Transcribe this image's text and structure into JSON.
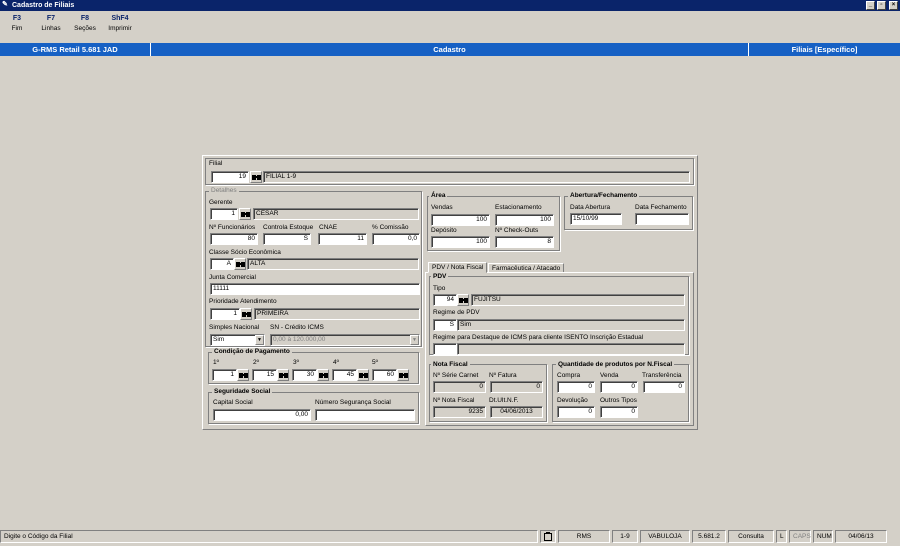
{
  "window": {
    "title": "Cadastro de Filiais"
  },
  "fkeys": [
    {
      "key": "F3",
      "label": "Fim"
    },
    {
      "key": "F7",
      "label": "Linhas"
    },
    {
      "key": "F8",
      "label": "Seções"
    },
    {
      "key": "ShF4",
      "label": "Imprimir"
    }
  ],
  "banner": {
    "left": "G-RMS Retail 5.681 JAD",
    "center": "Cadastro",
    "right": "Filiais [Específico]"
  },
  "filial": {
    "label": "Filial",
    "code": "19",
    "name": "FILIAL 1-9"
  },
  "detalhes": {
    "title": "Detalhes",
    "gerente_label": "Gerente",
    "gerente_code": "1",
    "gerente_name": "CESAR",
    "nfunc_label": "Nº Funcionários",
    "nfunc": "80",
    "ctrl_estoque_label": "Controla Estoque",
    "ctrl_estoque": "S",
    "cnae_label": "CNAE",
    "cnae": "11",
    "comissao_label": "% Comissão",
    "comissao": "0,0",
    "classe_label": "Classe Sócio Econômica",
    "classe_code": "A",
    "classe_name": "ALTA",
    "junta_label": "Junta Comercial",
    "junta": "11111",
    "prioridade_label": "Prioridade Atendimento",
    "prioridade_code": "1",
    "prioridade_name": "PRIMEIRA",
    "simples_label": "Simples Nacional",
    "simples": "Sim",
    "sn_credito_label": "SN - Crédito ICMS",
    "sn_credito": "0,00 à 120.000,00"
  },
  "condicao": {
    "title": "Condição de Pagamento",
    "items": [
      {
        "label": "1º",
        "value": "1"
      },
      {
        "label": "2º",
        "value": "15"
      },
      {
        "label": "3º",
        "value": "30"
      },
      {
        "label": "4º",
        "value": "45"
      },
      {
        "label": "5º",
        "value": "60"
      }
    ]
  },
  "seguridade": {
    "title": "Seguridade Social",
    "capital_label": "Capital Social",
    "capital": "0,00",
    "numero_label": "Número Segurança Social",
    "numero": ""
  },
  "area": {
    "title": "Área",
    "vendas_label": "Vendas",
    "vendas": "100",
    "estac_label": "Estacionamento",
    "estac": "100",
    "deposito_label": "Depósito",
    "deposito": "100",
    "checkouts_label": "Nº Check-Outs",
    "checkouts": "8"
  },
  "abertura": {
    "title": "Abertura/Fechamento",
    "abertura_label": "Data Abertura",
    "abertura": "15/10/99",
    "fechamento_label": "Data Fechamento",
    "fechamento": ""
  },
  "tabs": [
    {
      "label": "PDV / Nota Fiscal"
    },
    {
      "label": "Farmacêutica / Atacado"
    }
  ],
  "pdv": {
    "title": "PDV",
    "tipo_label": "Tipo",
    "tipo_code": "94",
    "tipo_name": "FUJITSU",
    "regime_label": "Regime de PDV",
    "regime_code": "S",
    "regime_name": "Sim",
    "destaque_label": "Regime para Destaque de ICMS para cliente ISENTO Inscrição Estadual",
    "destaque_code": "",
    "destaque_name": ""
  },
  "nota_fiscal": {
    "title": "Nota Fiscal",
    "serie_label": "Nº Série Carnet",
    "serie": "0",
    "fatura_label": "Nº Fatura",
    "fatura": "0",
    "nota_label": "Nº Nota Fiscal",
    "nota": "9235",
    "dt_ult_label": "Dt.Ult.N.F.",
    "dt_ult": "04/06/2013"
  },
  "quantidade": {
    "title": "Quantidade de produtos por N.Fiscal",
    "compra_label": "Compra",
    "compra": "0",
    "venda_label": "Venda",
    "venda": "0",
    "transf_label": "Transferência",
    "transf": "0",
    "devol_label": "Devolução",
    "devol": "0",
    "outros_label": "Outros Tipos",
    "outros": "0"
  },
  "status": {
    "message": "Digite o Código da Filial",
    "cells": [
      "RMS",
      "1-9",
      "VABULOJA",
      "5.681.2",
      "Consulta",
      "L",
      "CAPS",
      "NUM",
      "04/06/13"
    ]
  }
}
